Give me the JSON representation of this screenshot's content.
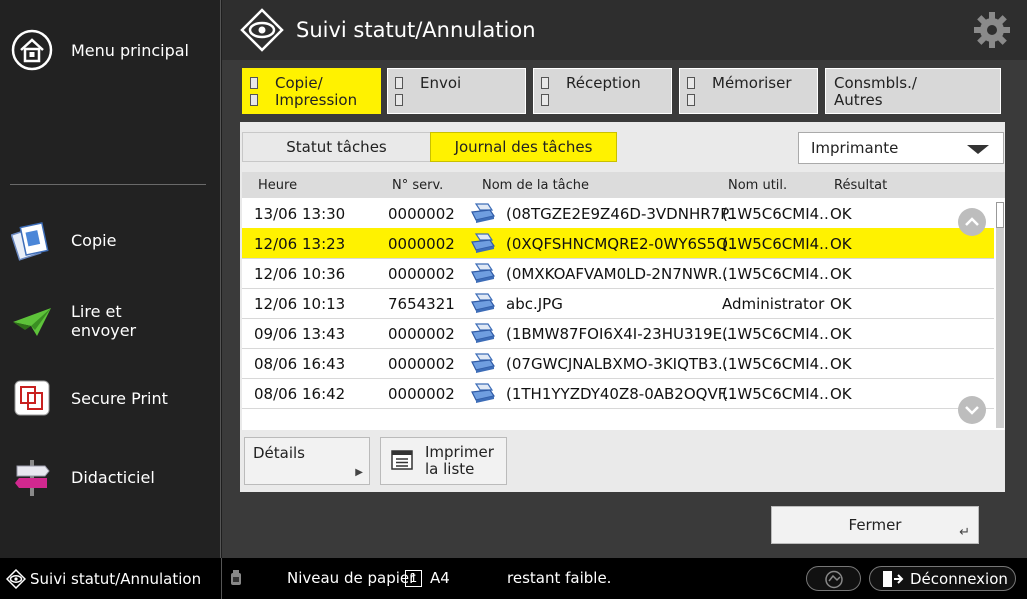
{
  "sidebar": {
    "menu_principal": "Menu principal",
    "items": [
      {
        "label": "Copie",
        "icon": "copy-icon"
      },
      {
        "label": "Lire et\nenvoyer",
        "icon": "scan-send-icon"
      },
      {
        "label": "Secure Print",
        "icon": "secure-print-icon"
      },
      {
        "label": "Didacticiel",
        "icon": "signpost-icon"
      }
    ]
  },
  "header": {
    "title": "Suivi statut/Annulation",
    "settings_icon": "gear-icon"
  },
  "category_tabs": [
    {
      "label": "Copie/\nImpression",
      "active": true
    },
    {
      "label": "Envoi",
      "active": false
    },
    {
      "label": "Réception",
      "active": false
    },
    {
      "label": "Mémoriser",
      "active": false
    },
    {
      "label": "Consmbls./\nAutres",
      "active": false
    }
  ],
  "subtabs": {
    "status": "Statut tâches",
    "log": "Journal des tâches"
  },
  "device_select": {
    "value": "Imprimante"
  },
  "table": {
    "headers": [
      "Heure",
      "N° serv.",
      "Nom de la tâche",
      "Nom util.",
      "Résultat"
    ],
    "rows": [
      {
        "time": "13/06 13:30",
        "serv": "0000002",
        "job": "(08TGZE2E9Z46D-3VDNHR7P..",
        "user": "(1W5C6CMI4..",
        "result": "OK",
        "selected": false
      },
      {
        "time": "12/06 13:23",
        "serv": "0000002",
        "job": "(0XQFSHNCMQRE2-0WY6S5Q..",
        "user": "(1W5C6CMI4..",
        "result": "OK",
        "selected": true
      },
      {
        "time": "12/06 10:36",
        "serv": "0000002",
        "job": "(0MXKOAFVAM0LD-2N7NWR..",
        "user": "(1W5C6CMI4..",
        "result": "OK",
        "selected": false
      },
      {
        "time": "12/06 10:13",
        "serv": "7654321",
        "job": "abc.JPG",
        "user": "Administrator",
        "result": "OK",
        "selected": false
      },
      {
        "time": "09/06 13:43",
        "serv": "0000002",
        "job": "(1BMW87FOI6X4I-23HU319E..",
        "user": "(1W5C6CMI4..",
        "result": "OK",
        "selected": false
      },
      {
        "time": "08/06 16:43",
        "serv": "0000002",
        "job": "(07GWCJNALBXMO-3KIQTB3..",
        "user": "(1W5C6CMI4..",
        "result": "OK",
        "selected": false
      },
      {
        "time": "08/06 16:42",
        "serv": "0000002",
        "job": "(1TH1YYZDY40Z8-0AB2OQVF..",
        "user": "(1W5C6CMI4..",
        "result": "OK",
        "selected": false
      }
    ]
  },
  "buttons": {
    "details": "Détails",
    "print_list": "Imprimer\nla liste",
    "close": "Fermer"
  },
  "statusbar": {
    "left_label": "Suivi statut/Annulation",
    "paper_level": "Niveau de papier",
    "tray": "1",
    "paper_size": "A4",
    "message": "restant faible.",
    "logout": "Déconnexion"
  }
}
